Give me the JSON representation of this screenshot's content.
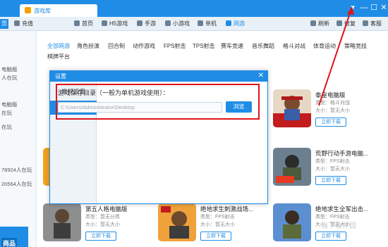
{
  "window": {
    "tab_title": "游戏库",
    "minimize": "—",
    "maximize": "☐",
    "close": "✕",
    "menu": "▾"
  },
  "nav": {
    "left_cut": "页",
    "items": [
      {
        "label": "充值",
        "icon": "coin-icon"
      },
      {
        "label": "首页",
        "icon": "home-icon"
      },
      {
        "label": "H5游戏",
        "icon": "h5-icon"
      },
      {
        "label": "手游",
        "icon": "phone-icon"
      },
      {
        "label": "小游戏",
        "icon": "gamepad-icon"
      },
      {
        "label": "单机",
        "icon": "pc-icon"
      },
      {
        "label": "网游",
        "icon": "online-icon"
      }
    ],
    "right": [
      {
        "label": "刷新",
        "icon": "refresh-icon"
      },
      {
        "label": "修复",
        "icon": "repair-icon"
      },
      {
        "label": "客服",
        "icon": "service-icon"
      }
    ]
  },
  "left_column": {
    "items": [
      {
        "text": "电脑版"
      },
      {
        "text": "人在玩"
      },
      {
        "text": "电脑版"
      },
      {
        "text": "在玩"
      },
      {
        "text": "在玩"
      },
      {
        "text": "78924人在玩",
        "num": "78924"
      },
      {
        "text": "20564人在玩",
        "num": "20564"
      }
    ],
    "mall": "商品"
  },
  "categories": {
    "row1": [
      "全部网游",
      "角色扮演",
      "回合制",
      "动作游戏",
      "FPS射击",
      "TPS射击",
      "赛车竞速",
      "音乐舞蹈",
      "格斗对战",
      "体育运动",
      "策略竞技"
    ],
    "row2": [
      "棋牌平台"
    ]
  },
  "cards": [
    {
      "title": "拳皇电脑版",
      "meta1": "类型：格斗对战",
      "meta2": "大小：暂无大小",
      "button": "立即下载",
      "image": "kof-art"
    },
    {
      "title": "荒野行动手游电脑...",
      "meta1": "类型：FPS射击",
      "meta2": "大小：暂无大小",
      "button": "立即下载",
      "image": "knives-out-art"
    },
    {
      "title": "第五人格电脑版",
      "meta1": "类型：暂无分类",
      "meta2": "大小：暂无大小",
      "button": "立即下载",
      "image": "identity-v-art"
    },
    {
      "title": "绝地求生刺激战场...",
      "meta1": "类型：FPS射击",
      "meta2": "大小：暂无大小",
      "button": "立即下载",
      "image": "pubg-exhilarating-art"
    },
    {
      "title": "绝地求生全军出击...",
      "meta1": "类型：FPS射击",
      "meta2": "大小：暂无大小",
      "button": "立即下载",
      "image": "pubg-allout-art"
    }
  ],
  "dialog": {
    "title": "设置",
    "close": "✕",
    "side": [
      "常规设置",
      "下载设置"
    ],
    "active_side": "下载设置",
    "save_label": "游戏保存目录（一般为单机游戏使用）：",
    "path_value": "C:\\Users\\Administrator\\Desktop",
    "browse": "浏览"
  },
  "watermark": "当下软件园",
  "colors": {
    "accent": "#1f8de6",
    "highlight": "#e0141b"
  }
}
